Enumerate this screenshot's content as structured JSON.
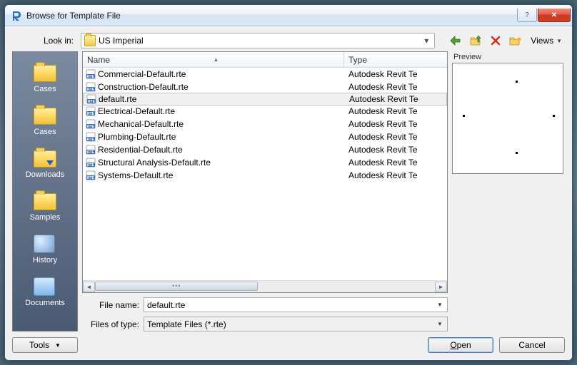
{
  "window": {
    "title": "Browse for Template File",
    "help_glyph": "?",
    "close_glyph": "✕"
  },
  "toolbar": {
    "look_in_label": "Look in:",
    "look_in_value": "US Imperial",
    "views_label": "Views"
  },
  "sidebar": {
    "items": [
      {
        "label": "Cases"
      },
      {
        "label": "Cases"
      },
      {
        "label": "Downloads"
      },
      {
        "label": "Samples"
      },
      {
        "label": "History"
      },
      {
        "label": "Documents"
      }
    ]
  },
  "list": {
    "columns": [
      "Name",
      "Type"
    ],
    "rows": [
      {
        "name": "Commercial-Default.rte",
        "type": "Autodesk Revit Te",
        "selected": false
      },
      {
        "name": "Construction-Default.rte",
        "type": "Autodesk Revit Te",
        "selected": false
      },
      {
        "name": "default.rte",
        "type": "Autodesk Revit Te",
        "selected": true
      },
      {
        "name": "Electrical-Default.rte",
        "type": "Autodesk Revit Te",
        "selected": false
      },
      {
        "name": "Mechanical-Default.rte",
        "type": "Autodesk Revit Te",
        "selected": false
      },
      {
        "name": "Plumbing-Default.rte",
        "type": "Autodesk Revit Te",
        "selected": false
      },
      {
        "name": "Residential-Default.rte",
        "type": "Autodesk Revit Te",
        "selected": false
      },
      {
        "name": "Structural Analysis-Default.rte",
        "type": "Autodesk Revit Te",
        "selected": false
      },
      {
        "name": "Systems-Default.rte",
        "type": "Autodesk Revit Te",
        "selected": false
      }
    ]
  },
  "inputs": {
    "filename_label": "File name:",
    "filename_value": "default.rte",
    "filetype_label": "Files of type:",
    "filetype_value": "Template Files  (*.rte)"
  },
  "preview": {
    "label": "Preview"
  },
  "buttons": {
    "tools": "Tools",
    "open_ul": "O",
    "open_rest": "pen",
    "cancel": "Cancel"
  }
}
